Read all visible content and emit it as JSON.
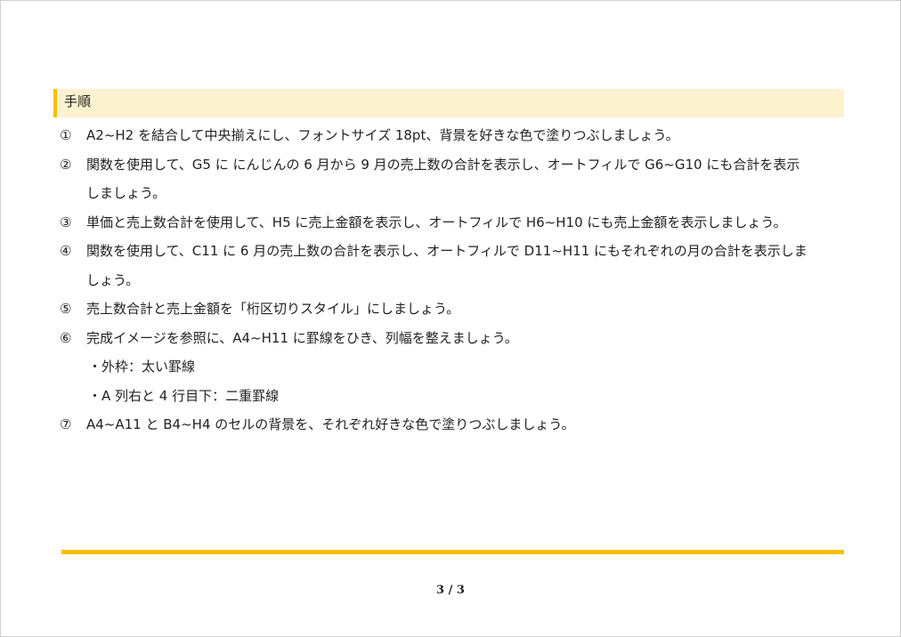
{
  "heading": "手順",
  "steps": [
    {
      "num": "①",
      "lines": [
        "A2~H2 を結合して中央揃えにし、フォントサイズ 18pt、背景を好きな色で塗りつぶしましょう。"
      ]
    },
    {
      "num": "②",
      "lines": [
        "関数を使用して、G5 に にんじんの 6 月から 9 月の売上数の合計を表示し、オートフィルで G6~G10 にも合計を表示",
        "しましょう。"
      ]
    },
    {
      "num": "③",
      "lines": [
        "単価と売上数合計を使用して、H5 に売上金額を表示し、オートフィルで H6~H10 にも売上金額を表示しましょう。"
      ]
    },
    {
      "num": "④",
      "lines": [
        "関数を使用して、C11 に 6 月の売上数の合計を表示し、オートフィルで D11~H11 にもそれぞれの月の合計を表示しま",
        "しょう。"
      ]
    },
    {
      "num": "⑤",
      "lines": [
        "売上数合計と売上金額を「桁区切りスタイル」にしましょう。"
      ]
    },
    {
      "num": "⑥",
      "lines": [
        "完成イメージを参照に、A4~H11 に罫線をひき、列幅を整えましょう。"
      ]
    },
    {
      "num": "⑦",
      "lines": [
        "A4~A11 と B4~H4 のセルの背景を、それぞれ好きな色で塗りつぶしましょう。"
      ]
    }
  ],
  "step6_subitems": [
    "・外枠：太い罫線",
    "・A 列右と 4 行目下：二重罫線"
  ],
  "page_number": "3 / 3",
  "colors": {
    "accent": "#f5c000",
    "heading_bg": "#fdf2cf"
  }
}
